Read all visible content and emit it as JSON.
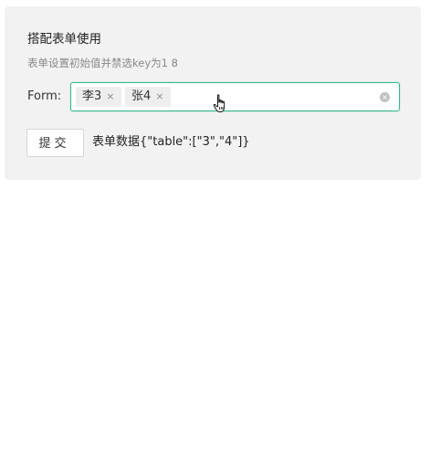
{
  "demo": {
    "title": "搭配表单使用",
    "description": "表单设置初始值并禁选key为1 8"
  },
  "form": {
    "label": "Form:",
    "selected_tags": [
      {
        "label": "李3",
        "close": "×"
      },
      {
        "label": "张4",
        "close": "×"
      }
    ],
    "clear_icon": "×"
  },
  "submit": {
    "label": "提交"
  },
  "form_data_text": "表单数据{\"table\":[\"3\",\"4\"]}",
  "colors": {
    "accent": "#2fb98b",
    "card_bg": "#f2f2f2"
  },
  "icons": {
    "cursor": "hand-pointer-icon",
    "clear": "clear-circle-icon",
    "tag_close": "close-icon"
  }
}
